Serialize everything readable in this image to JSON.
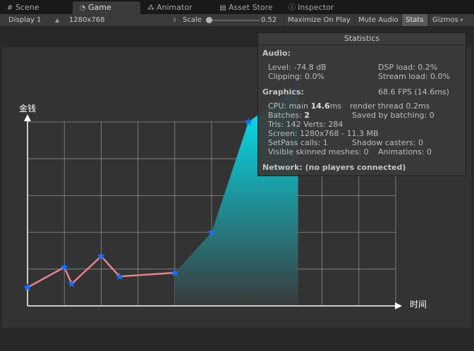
{
  "tabs": [
    {
      "label": "Scene",
      "icon": "grid-icon"
    },
    {
      "label": "Game",
      "icon": "pacman-icon",
      "active": true
    },
    {
      "label": "Animator",
      "icon": "animator-icon"
    },
    {
      "label": "Asset Store",
      "icon": "shopping-bag-icon"
    },
    {
      "label": "Inspector",
      "icon": "info-icon"
    }
  ],
  "toolbar": {
    "display": "Display 1",
    "resolution": "1280x768",
    "scale_label": "Scale",
    "scale_value": "0.52",
    "maximize_on_play": "Maximize On Play",
    "mute_audio": "Mute Audio",
    "stats": "Stats",
    "gizmos": "Gizmos"
  },
  "stats": {
    "title": "Statistics",
    "audio_header": "Audio:",
    "level": "Level: -74.8 dB",
    "dsp_load": "DSP load: 0.2%",
    "clipping": "Clipping: 0.0%",
    "stream_load": "Stream load: 0.0%",
    "graphics_header": "Graphics:",
    "fps": "68.6 FPS (14.6ms)",
    "cpu_prefix": "CPU: main ",
    "cpu_main": "14.6",
    "cpu_suffix": "ms",
    "render_thread": "render thread 0.2ms",
    "batches_prefix": "Batches: ",
    "batches": "2",
    "saved_by_batching": "Saved by batching: 0",
    "tris": "Tris: 142  Verts: 284",
    "screen": "Screen: 1280x768 - 11.3 MB",
    "setpass": "SetPass calls: 1",
    "shadow_casters": "Shadow casters: 0",
    "skinned": "Visible skinned meshes: 0",
    "animations": "Animations: 0",
    "network": "Network: (no players connected)"
  },
  "colors": {
    "line": "#e8828c",
    "marker": "#1a6fff",
    "fill_top": "#00f0ff",
    "fill_bottom": "#3a3a3a",
    "grid": "#8c8c8c",
    "axis": "#ffffff"
  },
  "chart_data": {
    "type": "line",
    "xlabel": "时间",
    "ylabel": "金钱",
    "grid": true,
    "x": [
      0,
      1,
      1.2,
      2,
      2.5,
      4,
      5,
      6,
      7.35
    ],
    "y": [
      0.5,
      1.05,
      0.6,
      1.35,
      0.8,
      0.9,
      2,
      5,
      6
    ],
    "markers": "star",
    "fill_from_index": 5
  }
}
